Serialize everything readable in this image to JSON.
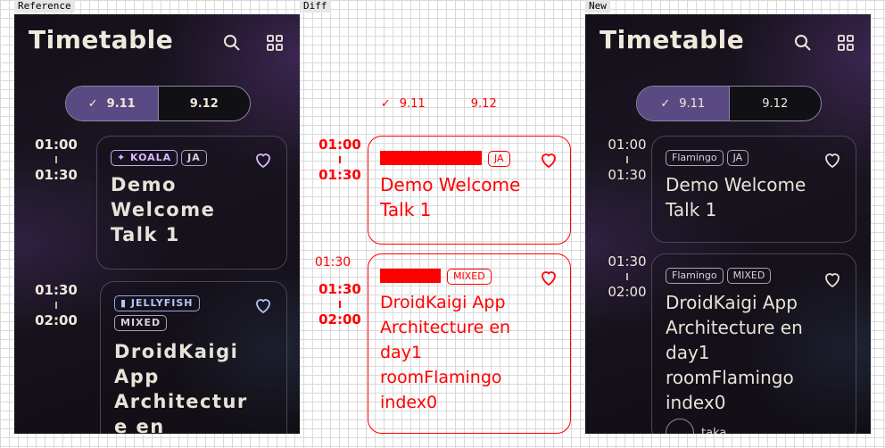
{
  "panels": {
    "reference": "Reference",
    "diff": "Diff",
    "new": "New"
  },
  "app": {
    "title": "Timetable",
    "icons": {
      "search": "search-icon",
      "grid": "grid-view-icon"
    },
    "days": [
      {
        "label": "9.11",
        "selected": true
      },
      {
        "label": "9.12",
        "selected": false
      }
    ]
  },
  "reference": {
    "sessions": [
      {
        "start": "01:00",
        "end": "01:30",
        "room": "✦ KOALA",
        "language": "JA",
        "title": "Demo Welcome Talk 1"
      },
      {
        "start": "01:30",
        "end": "02:00",
        "room": "▮ JELLYFISH",
        "language": "MIXED",
        "title": "DroidKaigi App Architecture en"
      }
    ]
  },
  "new": {
    "sessions": [
      {
        "start": "01:00",
        "end": "01:30",
        "room": "Flamingo",
        "language": "JA",
        "title": "Demo Welcome Talk 1"
      },
      {
        "start": "01:30",
        "end": "02:00",
        "room": "Flamingo",
        "language": "MIXED",
        "title": "DroidKaigi App Architecture en day1 roomFlamingo index0",
        "speaker": "taka"
      }
    ]
  },
  "diff": {
    "rows": [
      {
        "start": "01:00",
        "end": "01:30"
      },
      {
        "start": "01:30",
        "end": "02:00"
      }
    ]
  },
  "colors": {
    "background": "#15111b",
    "selected_day": "#5a4a84",
    "text": "#efe9dc",
    "diff": "#ff0000"
  }
}
